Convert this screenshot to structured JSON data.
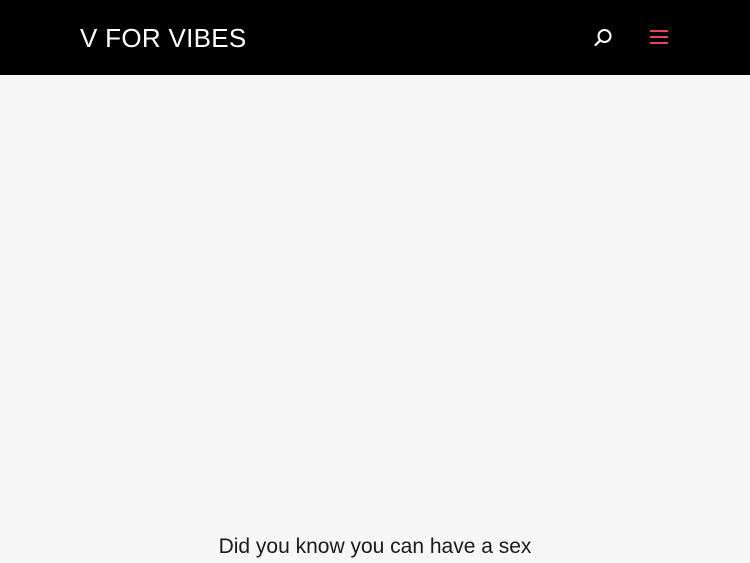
{
  "header": {
    "logo_text": "V FOR VIBES",
    "search_icon": "search-icon",
    "menu_icon": "hamburger-menu-icon",
    "background_color": "#000000",
    "accent_color": "#e8435a"
  },
  "main": {
    "headline_text": "Did you know you can have a sex"
  }
}
